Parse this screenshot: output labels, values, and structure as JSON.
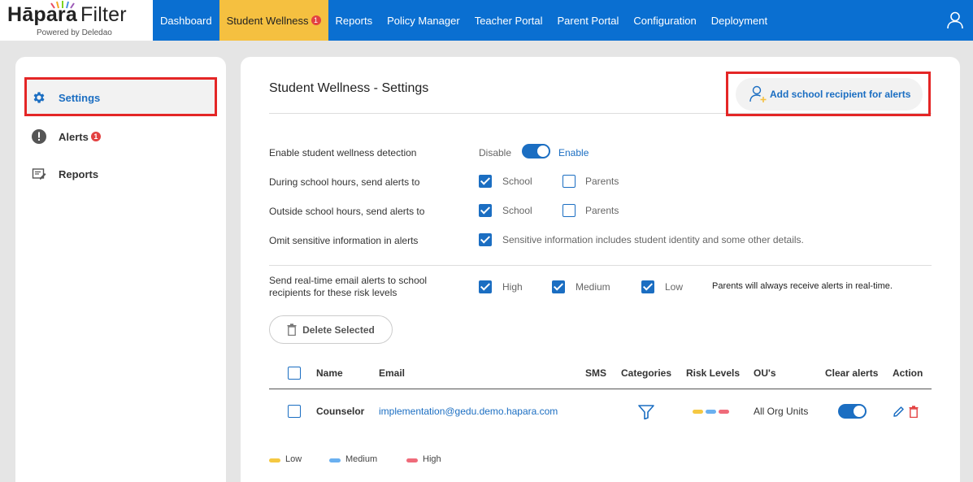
{
  "brand": {
    "name": "Hāpara",
    "product": "Filter",
    "tagline": "Powered by Deledao"
  },
  "nav": {
    "items": [
      {
        "label": "Dashboard"
      },
      {
        "label": "Student Wellness",
        "badge": "1",
        "active": true
      },
      {
        "label": "Reports"
      },
      {
        "label": "Policy Manager"
      },
      {
        "label": "Teacher Portal"
      },
      {
        "label": "Parent Portal"
      },
      {
        "label": "Configuration"
      },
      {
        "label": "Deployment"
      }
    ],
    "user_icon": "user-icon"
  },
  "sidebar": {
    "settings": {
      "label": "Settings",
      "icon": "gear-icon"
    },
    "alerts": {
      "label": "Alerts",
      "badge": "1",
      "icon": "exclamation-circle-icon"
    },
    "reports": {
      "label": "Reports",
      "icon": "report-icon"
    }
  },
  "main": {
    "title": "Student Wellness - Settings",
    "add_recipient_label": "Add school recipient for alerts",
    "settings": {
      "enable_label": "Enable student wellness detection",
      "disable_text": "Disable",
      "enable_text": "Enable",
      "during_label": "During school hours, send alerts to",
      "outside_label": "Outside school hours, send alerts to",
      "school_text": "School",
      "parents_text": "Parents",
      "omit_label": "Omit sensitive information in alerts",
      "omit_note": "Sensitive information includes student identity and some other details.",
      "realtime_label_1": "Send real-time email alerts to school",
      "realtime_label_2": "recipients for these risk levels",
      "high_text": "High",
      "medium_text": "Medium",
      "low_text": "Low",
      "parents_note": "Parents will always receive alerts in real-time."
    },
    "delete_label": "Delete Selected",
    "table": {
      "headers": {
        "name": "Name",
        "email": "Email",
        "sms": "SMS",
        "categories": "Categories",
        "risk_levels": "Risk Levels",
        "ous": "OU's",
        "clear_alerts": "Clear alerts",
        "action": "Action"
      },
      "rows": [
        {
          "name": "Counselor",
          "email": "implementation@gedu.demo.hapara.com",
          "sms": "",
          "ous": "All Org Units",
          "clear_alerts": true
        }
      ]
    },
    "legend": {
      "low": "Low",
      "medium": "Medium",
      "high": "High"
    }
  },
  "colors": {
    "nav_bg": "#0a6fd1",
    "active_tab": "#f5c040",
    "accent": "#1b6ec2",
    "badge": "#e34141",
    "low": "#f5c842",
    "medium": "#6ab0f0",
    "high": "#ef6b7a",
    "highlight_box": "#e42626"
  }
}
